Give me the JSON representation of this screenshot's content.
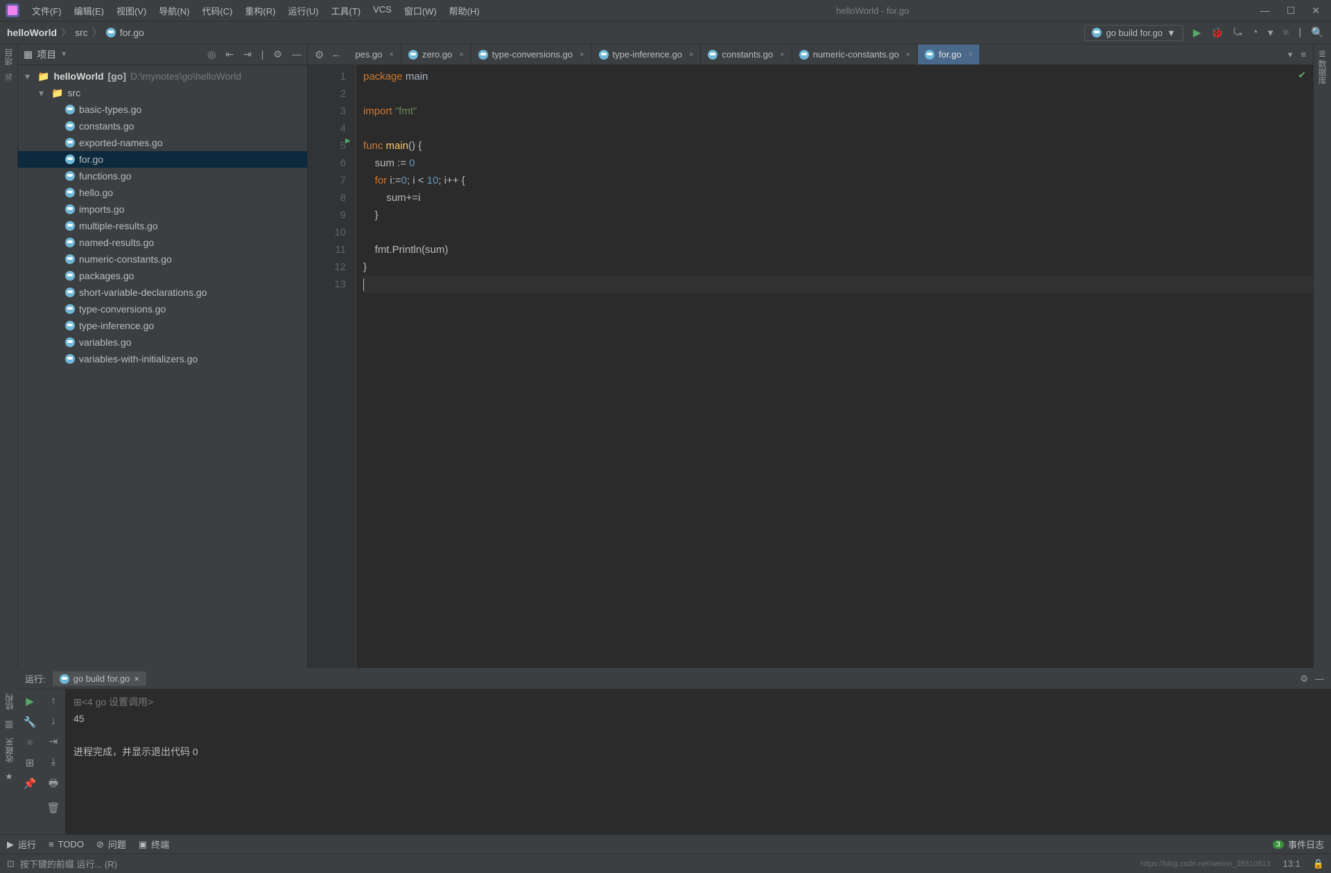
{
  "window_title": "helloWorld - for.go",
  "menus": [
    "文件(F)",
    "编辑(E)",
    "视图(V)",
    "导航(N)",
    "代码(C)",
    "重构(R)",
    "运行(U)",
    "工具(T)",
    "VCS",
    "窗口(W)",
    "帮助(H)"
  ],
  "breadcrumbs": {
    "project": "helloWorld",
    "folder": "src",
    "file": "for.go"
  },
  "run_config": "go build for.go",
  "sidebar": {
    "title": "项目",
    "root": {
      "name": "helloWorld",
      "tag": "[go]",
      "path": "D:\\mynotes\\go\\helloWorld"
    },
    "folder": "src",
    "files": [
      "basic-types.go",
      "constants.go",
      "exported-names.go",
      "for.go",
      "functions.go",
      "hello.go",
      "imports.go",
      "multiple-results.go",
      "named-results.go",
      "numeric-constants.go",
      "packages.go",
      "short-variable-declarations.go",
      "type-conversions.go",
      "type-inference.go",
      "variables.go",
      "variables-with-initializers.go"
    ],
    "selected": "for.go"
  },
  "tabs": [
    {
      "label": "pes.go",
      "partial": true
    },
    {
      "label": "zero.go"
    },
    {
      "label": "type-conversions.go"
    },
    {
      "label": "type-inference.go"
    },
    {
      "label": "constants.go"
    },
    {
      "label": "numeric-constants.go"
    },
    {
      "label": "for.go",
      "active": true
    }
  ],
  "code": {
    "lines": [
      [
        {
          "t": "package ",
          "c": "kw"
        },
        {
          "t": "main",
          "c": "pkg"
        }
      ],
      [
        {
          "t": ""
        }
      ],
      [
        {
          "t": "import ",
          "c": "kw"
        },
        {
          "t": "\"fmt\"",
          "c": "str"
        }
      ],
      [
        {
          "t": ""
        }
      ],
      [
        {
          "t": "func ",
          "c": "kw"
        },
        {
          "t": "main",
          "c": "fn"
        },
        {
          "t": "() {"
        }
      ],
      [
        {
          "t": "    sum := "
        },
        {
          "t": "0",
          "c": "num"
        }
      ],
      [
        {
          "t": "    "
        },
        {
          "t": "for ",
          "c": "kw"
        },
        {
          "t": "i:="
        },
        {
          "t": "0",
          "c": "num"
        },
        {
          "t": "; i < "
        },
        {
          "t": "10",
          "c": "num"
        },
        {
          "t": "; i++ {"
        }
      ],
      [
        {
          "t": "        sum+=i"
        }
      ],
      [
        {
          "t": "    }"
        }
      ],
      [
        {
          "t": ""
        }
      ],
      [
        {
          "t": "    fmt.Println(sum)"
        }
      ],
      [
        {
          "t": "}"
        }
      ],
      [
        {
          "t": "",
          "current": true
        }
      ]
    ]
  },
  "run": {
    "label": "运行:",
    "tab": "go build for.go",
    "header": "<4 go 设置调用>",
    "output": "45",
    "exit": "进程完成，并显示退出代码 0"
  },
  "bottom": {
    "run": "运行",
    "todo": "TODO",
    "problems": "问题",
    "terminal": "终端",
    "eventlog": "事件日志",
    "eventcount": "3"
  },
  "status": {
    "hint": "按下键的前缀 运行... (R)",
    "pos": "13:1",
    "url": "https://blog.csdn.net/weixin_38510813"
  },
  "leftrail": "项目",
  "rightrail": "数据库",
  "lefttools": [
    "结构",
    "收藏夹"
  ]
}
